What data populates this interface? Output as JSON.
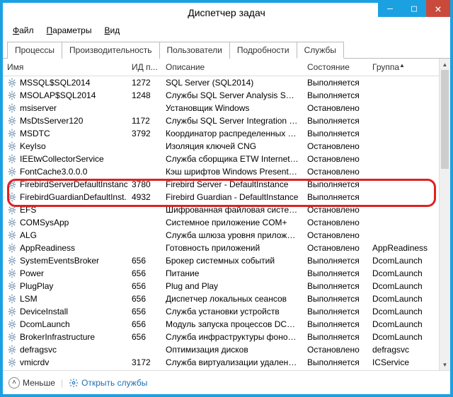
{
  "window": {
    "title": "Диспетчер задач"
  },
  "controls": {
    "min": "—",
    "max": "□",
    "close": "×"
  },
  "menu": {
    "file": "Файл",
    "options": "Параметры",
    "view": "Вид",
    "file_u": "Ф",
    "options_u": "П",
    "view_u": "В"
  },
  "tabs": {
    "processes": "Процессы",
    "performance": "Производительность",
    "users": "Пользователи",
    "details": "Подробности",
    "services": "Службы"
  },
  "columns": {
    "name": "Имя",
    "pid": "ИД п...",
    "desc": "Описание",
    "status": "Состояние",
    "group": "Группа"
  },
  "status": {
    "running": "Выполняется",
    "stopped": "Остановлено"
  },
  "services": [
    {
      "name": "MSSQL$SQL2014",
      "pid": "1272",
      "desc": "SQL Server (SQL2014)",
      "st": "running",
      "grp": ""
    },
    {
      "name": "MSOLAP$SQL2014",
      "pid": "1248",
      "desc": "Службы SQL Server Analysis Servic...",
      "st": "running",
      "grp": ""
    },
    {
      "name": "msiserver",
      "pid": "",
      "desc": "Установщик Windows",
      "st": "stopped",
      "grp": ""
    },
    {
      "name": "MsDtsServer120",
      "pid": "1172",
      "desc": "Службы SQL Server Integration Ser...",
      "st": "running",
      "grp": ""
    },
    {
      "name": "MSDTC",
      "pid": "3792",
      "desc": "Координатор распределенных тра...",
      "st": "running",
      "grp": ""
    },
    {
      "name": "KeyIso",
      "pid": "",
      "desc": "Изоляция ключей CNG",
      "st": "stopped",
      "grp": ""
    },
    {
      "name": "IEEtwCollectorService",
      "pid": "",
      "desc": "Служба сборщика ETW Internet Ex...",
      "st": "stopped",
      "grp": ""
    },
    {
      "name": "FontCache3.0.0.0",
      "pid": "",
      "desc": "Кэш шрифтов Windows Presentati...",
      "st": "stopped",
      "grp": ""
    },
    {
      "name": "FirebirdServerDefaultInstance",
      "pid": "3780",
      "desc": "Firebird Server - DefaultInstance",
      "st": "running",
      "grp": "",
      "hl": true
    },
    {
      "name": "FirebirdGuardianDefaultInst...",
      "pid": "4932",
      "desc": "Firebird Guardian - DefaultInstance",
      "st": "running",
      "grp": "",
      "hl": true
    },
    {
      "name": "EFS",
      "pid": "",
      "desc": "Шифрованная файловая система ...",
      "st": "stopped",
      "grp": ""
    },
    {
      "name": "COMSysApp",
      "pid": "",
      "desc": "Системное приложение COM+",
      "st": "stopped",
      "grp": ""
    },
    {
      "name": "ALG",
      "pid": "",
      "desc": "Служба шлюза уровня приложен...",
      "st": "stopped",
      "grp": ""
    },
    {
      "name": "AppReadiness",
      "pid": "",
      "desc": "Готовность приложений",
      "st": "stopped",
      "grp": "AppReadiness"
    },
    {
      "name": "SystemEventsBroker",
      "pid": "656",
      "desc": "Брокер системных событий",
      "st": "running",
      "grp": "DcomLaunch"
    },
    {
      "name": "Power",
      "pid": "656",
      "desc": "Питание",
      "st": "running",
      "grp": "DcomLaunch"
    },
    {
      "name": "PlugPlay",
      "pid": "656",
      "desc": "Plug and Play",
      "st": "running",
      "grp": "DcomLaunch"
    },
    {
      "name": "LSM",
      "pid": "656",
      "desc": "Диспетчер локальных сеансов",
      "st": "running",
      "grp": "DcomLaunch"
    },
    {
      "name": "DeviceInstall",
      "pid": "656",
      "desc": "Служба установки устройств",
      "st": "running",
      "grp": "DcomLaunch"
    },
    {
      "name": "DcomLaunch",
      "pid": "656",
      "desc": "Модуль запуска процессов DCOM...",
      "st": "running",
      "grp": "DcomLaunch"
    },
    {
      "name": "BrokerInfrastructure",
      "pid": "656",
      "desc": "Служба инфраструктуры фоновы...",
      "st": "running",
      "grp": "DcomLaunch"
    },
    {
      "name": "defragsvc",
      "pid": "",
      "desc": "Оптимизация дисков",
      "st": "stopped",
      "grp": "defragsvc"
    },
    {
      "name": "vmicrdv",
      "pid": "3172",
      "desc": "Служба виртуализации удаленны...",
      "st": "running",
      "grp": "ICService"
    }
  ],
  "footer": {
    "fewer": "Меньше",
    "open": "Открыть службы"
  }
}
